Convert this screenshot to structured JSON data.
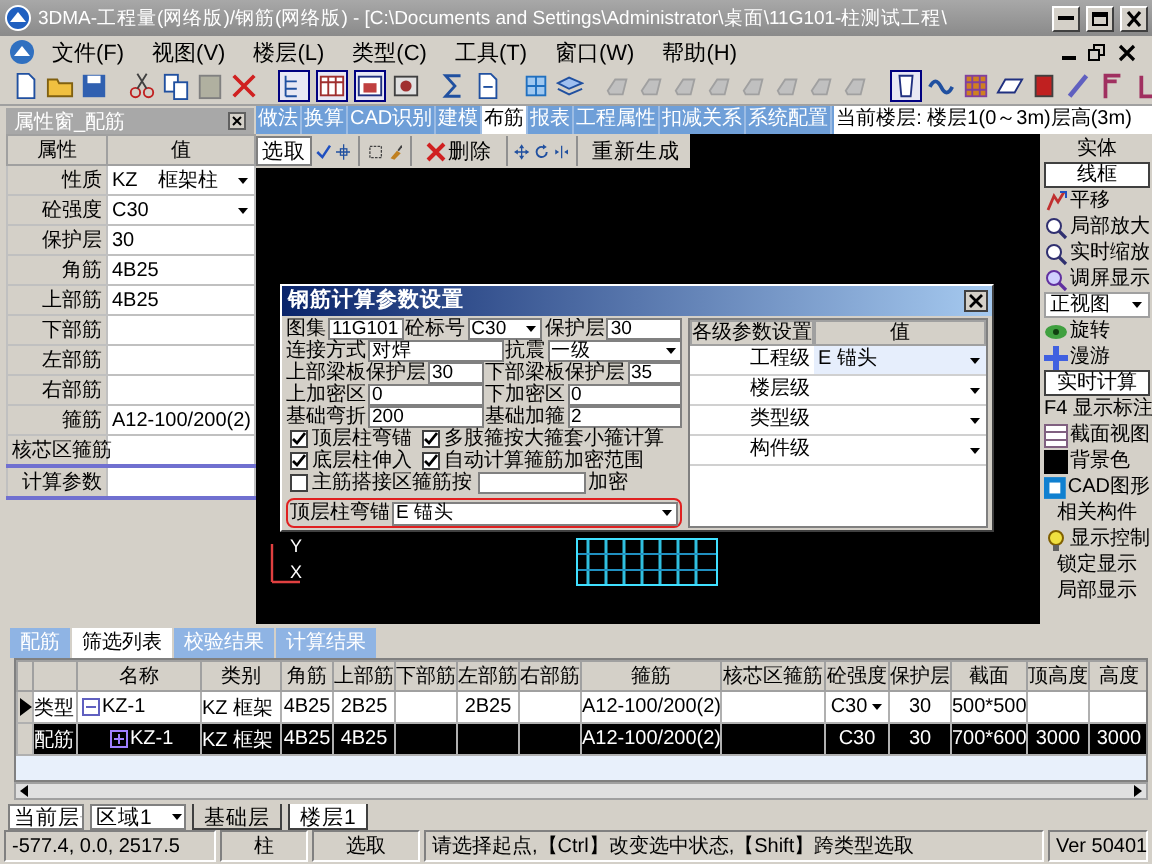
{
  "window": {
    "title": "3DMA-工程量(网络版)/钢筋(网络版) - [C:\\Documents and Settings\\Administrator\\桌面\\11G101-柱测试工程\\"
  },
  "menu": [
    "文件(F)",
    "视图(V)",
    "楼层(L)",
    "类型(C)",
    "工具(T)",
    "窗口(W)",
    "帮助(H)"
  ],
  "property_panel": {
    "title": "属性窗_配筋",
    "columns": [
      "属性",
      "值"
    ],
    "rows": [
      {
        "name": "性质",
        "value": "KZ　框架柱",
        "kind": "dropdown",
        "selected": false
      },
      {
        "name": "砼强度",
        "value": "C30",
        "kind": "dropdown",
        "selected": false
      },
      {
        "name": "保护层",
        "value": "30",
        "kind": "text",
        "selected": false
      },
      {
        "name": "角筋",
        "value": "4B25",
        "kind": "text",
        "selected": false
      },
      {
        "name": "上部筋",
        "value": "4B25",
        "kind": "text",
        "selected": false
      },
      {
        "name": "下部筋",
        "kind": "text",
        "selected": false
      },
      {
        "name": "左部筋",
        "kind": "text",
        "selected": false
      },
      {
        "name": "右部筋",
        "kind": "text",
        "selected": false
      },
      {
        "name": "箍筋",
        "value": "A12-100/200(2)",
        "kind": "text",
        "selected": false
      },
      {
        "name": "核芯区箍筋",
        "kind": "text",
        "selected": false
      },
      {
        "name": "计算参数",
        "kind": "text",
        "selected": true
      }
    ]
  },
  "module_tabs": [
    {
      "label": "做法",
      "selected": false
    },
    {
      "label": "换算",
      "selected": false
    },
    {
      "label": "CAD识别",
      "selected": false
    },
    {
      "label": "建模",
      "selected": false
    },
    {
      "label": "布筋",
      "selected": true
    },
    {
      "label": "报表",
      "selected": false
    },
    {
      "label": "工程属性",
      "selected": false
    },
    {
      "label": "扣减关系",
      "selected": false
    },
    {
      "label": "系统配置",
      "selected": false
    }
  ],
  "current_floor": "当前楼层: 楼层1(0～3m)层高(3m)",
  "edit_toolbar": [
    {
      "label": "选取",
      "selected": true
    },
    {
      "label": "删除",
      "selected": false
    },
    {
      "label": "重新生成",
      "selected": false
    }
  ],
  "canvas": {
    "axis_labels": [
      "Y",
      "X"
    ]
  },
  "dialog": {
    "title": "钢筋计算参数设置",
    "rows": [
      [
        {
          "kind": "label",
          "label": "图集"
        },
        {
          "kind": "dropdown",
          "value": "11G101"
        },
        {
          "kind": "label",
          "label": "砼标号"
        },
        {
          "kind": "dropdown",
          "value": "C30"
        },
        {
          "kind": "label",
          "label": "保护层"
        },
        {
          "kind": "input",
          "value": "30"
        }
      ],
      [
        {
          "kind": "label",
          "label": "连接方式"
        },
        {
          "kind": "input",
          "value": "对焊"
        },
        {
          "kind": "label",
          "label": "抗震"
        },
        {
          "kind": "dropdown",
          "value": "一级"
        }
      ],
      [
        {
          "kind": "label",
          "label": "上部梁板保护层"
        },
        {
          "kind": "input",
          "value": "30"
        },
        {
          "kind": "label",
          "label": "下部梁板保护层"
        },
        {
          "kind": "input",
          "value": "35"
        }
      ],
      [
        {
          "kind": "label",
          "label": "上加密区"
        },
        {
          "kind": "input",
          "value": "0"
        },
        {
          "kind": "label",
          "label": "下加密区"
        },
        {
          "kind": "input",
          "value": "0"
        }
      ],
      [
        {
          "kind": "label",
          "label": "基础弯折"
        },
        {
          "kind": "input",
          "value": "200"
        },
        {
          "kind": "label",
          "label": "基础加箍"
        },
        {
          "kind": "input",
          "value": "2"
        }
      ],
      [
        {
          "kind": "checkbox",
          "label": "顶层柱弯锚",
          "checked": true
        },
        {
          "kind": "checkbox",
          "label": "多肢箍按大箍套小箍计算",
          "checked": true
        }
      ],
      [
        {
          "kind": "checkbox",
          "label": "底层柱伸入",
          "checked": true
        },
        {
          "kind": "checkbox",
          "label": "自动计算箍筋加密范围",
          "checked": true
        }
      ],
      [
        {
          "kind": "checkbox",
          "label": "主筋搭接区箍筋按",
          "checked": false
        },
        {
          "kind": "input"
        },
        {
          "kind": "label",
          "label": "加密"
        }
      ]
    ],
    "anchor_setting": {
      "label": "顶层柱弯锚",
      "value": "E 锚头",
      "highlighted": true
    },
    "levels": {
      "columns": [
        "各级参数设置",
        "值"
      ],
      "rows": [
        {
          "name": "工程级",
          "value": "E 锚头",
          "selected": true
        },
        {
          "name": "楼层级",
          "selected": false
        },
        {
          "name": "类型级",
          "selected": false
        },
        {
          "name": "构件级",
          "selected": false
        }
      ]
    }
  },
  "right_panel": [
    {
      "kind": "header",
      "label": "实体"
    },
    {
      "kind": "toggle",
      "label": "线框"
    },
    {
      "kind": "tool",
      "label": "平移"
    },
    {
      "kind": "tool",
      "label": "局部放大"
    },
    {
      "kind": "tool",
      "label": "实时缩放"
    },
    {
      "kind": "tool",
      "label": "调屏显示"
    },
    {
      "kind": "dropdown",
      "label": "正视图"
    },
    {
      "kind": "tool",
      "label": "旋转"
    },
    {
      "kind": "tool",
      "label": "漫游"
    },
    {
      "kind": "toggle",
      "label": "实时计算"
    },
    {
      "kind": "plain",
      "label": "F4 显示标注"
    },
    {
      "kind": "tool",
      "label": "截面视图"
    },
    {
      "kind": "tool",
      "label": "背景色"
    },
    {
      "kind": "tool",
      "label": "CAD图形"
    },
    {
      "kind": "header",
      "label": "相关构件"
    },
    {
      "kind": "tool",
      "label": "显示控制"
    },
    {
      "kind": "header",
      "label": "锁定显示"
    },
    {
      "kind": "header",
      "label": "局部显示"
    }
  ],
  "bottom_tabs": [
    {
      "label": "配筋",
      "selected": false
    },
    {
      "label": "筛选列表",
      "selected": true
    },
    {
      "label": "校验结果",
      "selected": false
    },
    {
      "label": "计算结果",
      "selected": false
    }
  ],
  "table": {
    "name_column": "名称",
    "columns": [
      "类别",
      "角筋",
      "上部筋",
      "下部筋",
      "左部筋",
      "右部筋",
      "箍筋",
      "核芯区箍筋",
      "砼强度",
      "保护层",
      "截面",
      "顶高度",
      "高度"
    ],
    "rows": [
      {
        "type": "类型",
        "name": "KZ-1",
        "current": true,
        "selected": false,
        "expanded": true,
        "cells": [
          "KZ 框架",
          "4B25",
          "2B25",
          null,
          "2B25",
          null,
          "A12-100/200(2)",
          null,
          "C30",
          "30",
          "500*500",
          null,
          null
        ],
        "children": [
          {
            "type": "配筋",
            "name": "KZ-1",
            "current": false,
            "selected": true,
            "expanded": false,
            "cells": [
              "KZ 框架",
              "4B25",
              "4B25",
              null,
              null,
              null,
              "A12-100/200(2)",
              null,
              "C30",
              "30",
              "700*600",
              "3000",
              "3000"
            ]
          }
        ]
      }
    ]
  },
  "layer_bar": {
    "scope": "当前层",
    "region": "区域1",
    "floors": [
      {
        "label": "基础层",
        "selected": false
      },
      {
        "label": "楼层1",
        "selected": true
      }
    ]
  },
  "status_bar": [
    "-577.4, 0.0, 2517.5",
    "柱",
    "选取",
    "请选择起点,【Ctrl】改变选中状态,【Shift】跨类型选取",
    "Ver 50401"
  ]
}
